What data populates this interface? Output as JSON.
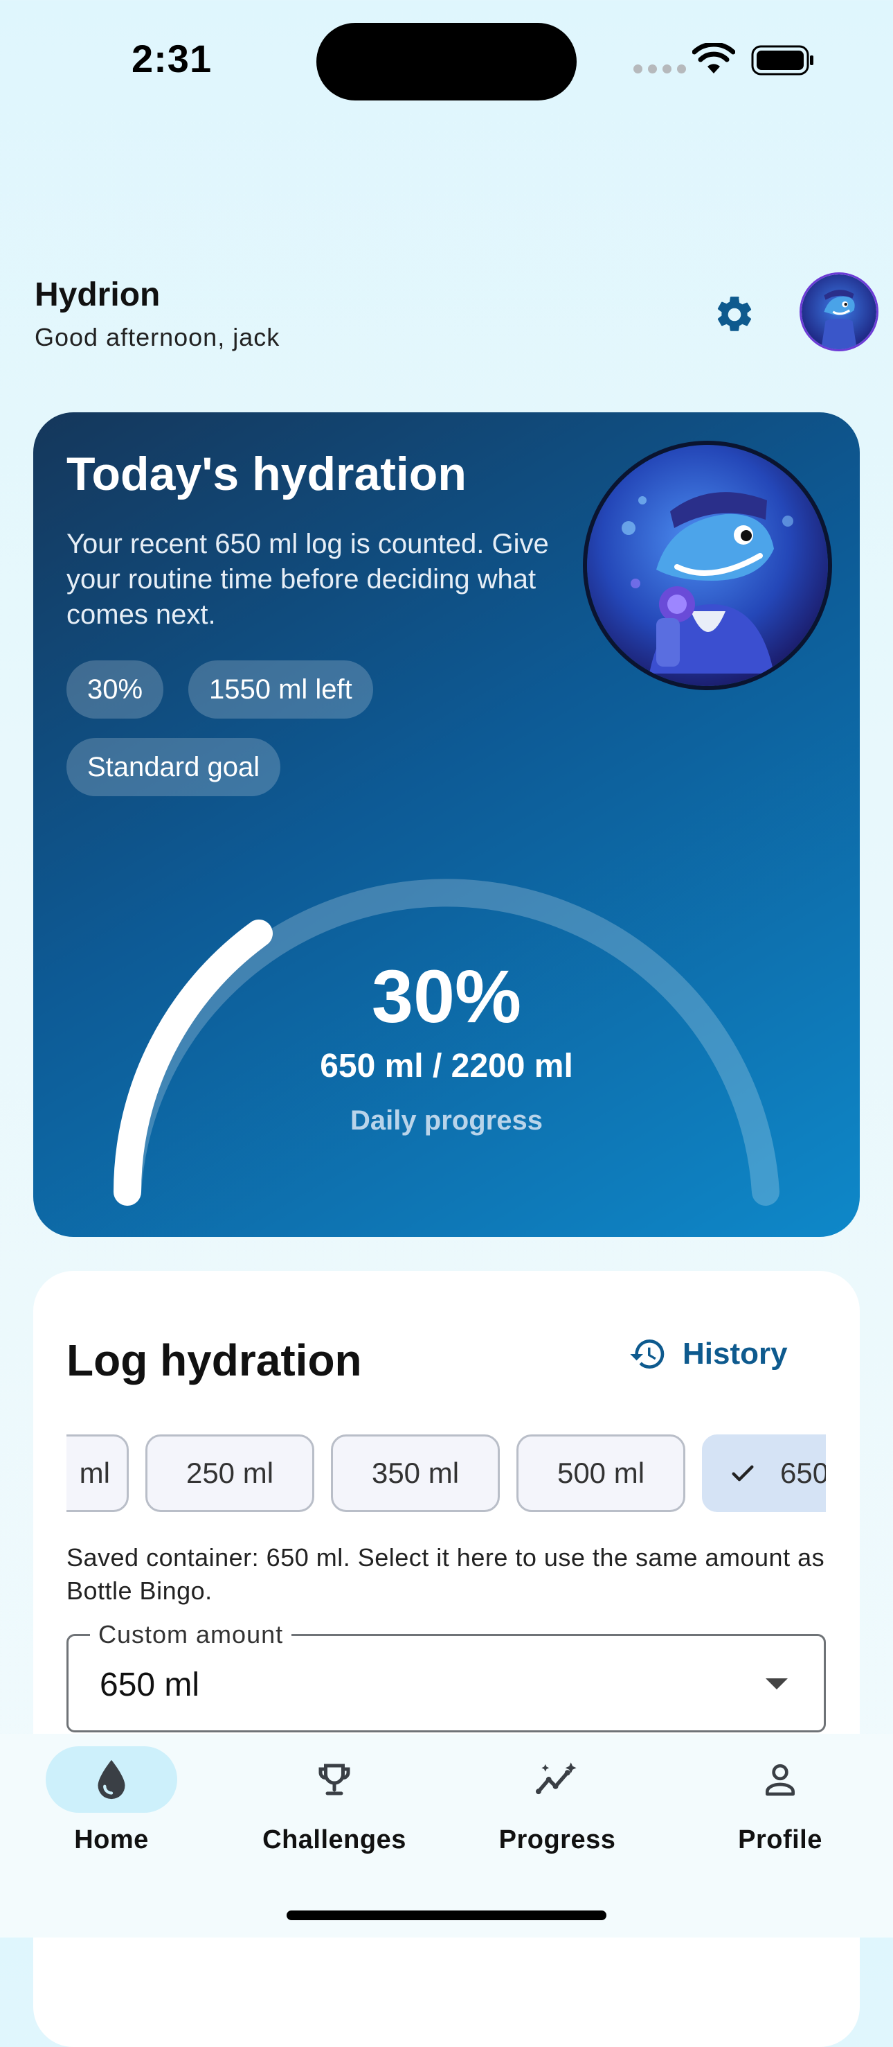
{
  "status_bar": {
    "time": "2:31"
  },
  "header": {
    "title": "Hydrion",
    "greeting": "Good afternoon, jack"
  },
  "hero": {
    "title": "Today's hydration",
    "subtitle": "Your recent 650 ml log is counted. Give your routine time before deciding what comes next.",
    "chips": [
      "30%",
      "1550 ml left",
      "Standard goal"
    ],
    "progress_percent_label": "30%",
    "progress_fraction": 0.3,
    "amount_label": "650 ml / 2200 ml",
    "caption": "Daily progress"
  },
  "log": {
    "title": "Log hydration",
    "history_label": "History",
    "amounts": [
      "ml",
      "250 ml",
      "350 ml",
      "500 ml",
      "650"
    ],
    "selected_index": 4,
    "helper_text": "Saved container: 650 ml. Select it here to use the same amount as Bottle Bingo.",
    "custom_label": "Custom amount",
    "custom_value": "650 ml"
  },
  "nav": {
    "items": [
      {
        "label": "Home",
        "icon": "water-drop-icon",
        "active": true
      },
      {
        "label": "Challenges",
        "icon": "trophy-icon",
        "active": false
      },
      {
        "label": "Progress",
        "icon": "trend-icon",
        "active": false
      },
      {
        "label": "Profile",
        "icon": "person-icon",
        "active": false
      }
    ]
  },
  "colors": {
    "accent": "#0e5a8e",
    "nav_active": "#cdf0fb",
    "hero_start": "#15375b",
    "hero_end": "#0e88c9"
  }
}
